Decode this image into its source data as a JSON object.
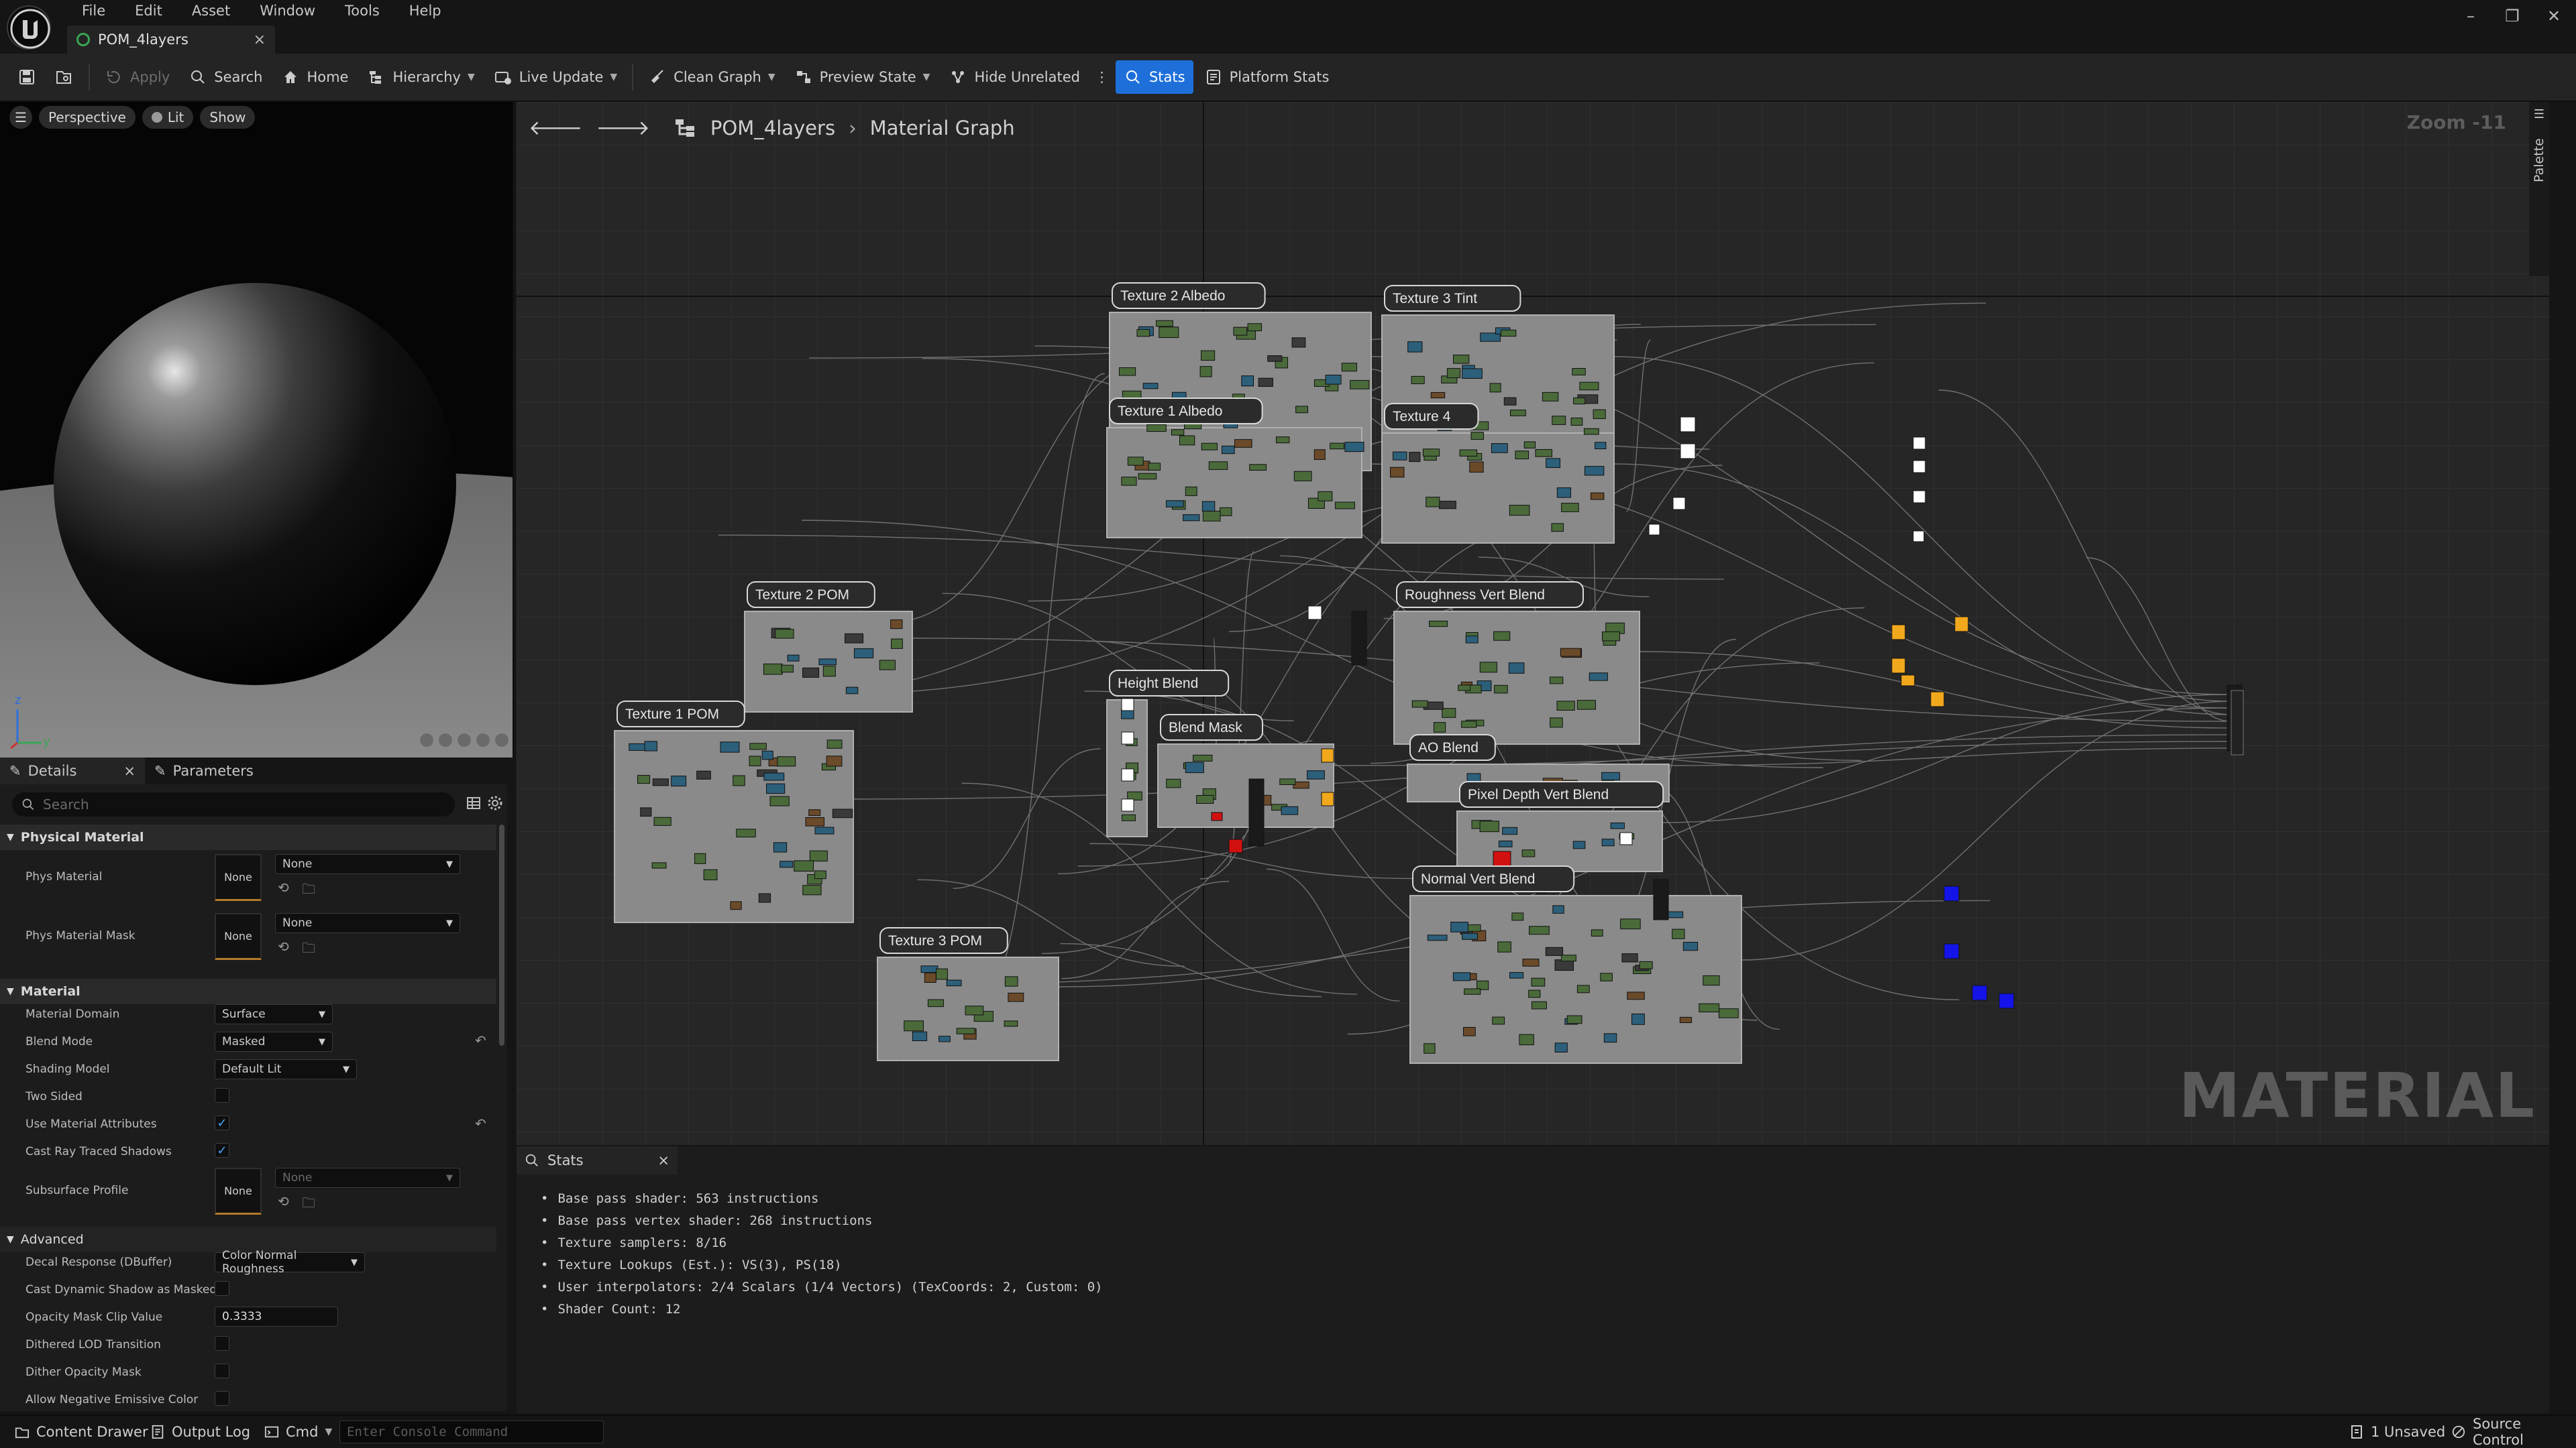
{
  "app": {
    "logo_icon": "unreal-engine-logo",
    "menu": [
      "File",
      "Edit",
      "Asset",
      "Window",
      "Tools",
      "Help"
    ],
    "document_tab": {
      "label": "POM_4layers",
      "icon": "material-icon",
      "close": "×"
    },
    "window_controls": [
      "–",
      "❐",
      "✕"
    ]
  },
  "toolbar": {
    "save_icon": "save-icon",
    "browse_icon": "browse-icon",
    "apply": "Apply",
    "search": "Search",
    "home": "Home",
    "hierarchy": "Hierarchy",
    "live_update": "Live Update",
    "clean_graph": "Clean Graph",
    "preview_state": "Preview State",
    "hide_unrelated": "Hide Unrelated",
    "stats": "Stats",
    "platform_stats": "Platform Stats"
  },
  "viewport": {
    "perspective": "Perspective",
    "lit": "Lit",
    "show": "Show"
  },
  "details": {
    "tabs": [
      "Details",
      "Parameters"
    ],
    "search_placeholder": "Search",
    "categories": {
      "physical_material": "Physical Material",
      "material": "Material",
      "advanced": "Advanced"
    },
    "props": {
      "phys_material": {
        "label": "Phys Material",
        "thumb": "None",
        "value": "None"
      },
      "phys_material_mask": {
        "label": "Phys Material Mask",
        "thumb": "None",
        "value": "None"
      },
      "material_domain": {
        "label": "Material Domain",
        "value": "Surface"
      },
      "blend_mode": {
        "label": "Blend Mode",
        "value": "Masked"
      },
      "shading_model": {
        "label": "Shading Model",
        "value": "Default Lit"
      },
      "two_sided": {
        "label": "Two Sided",
        "checked": false
      },
      "use_material_attributes": {
        "label": "Use Material Attributes",
        "checked": true
      },
      "cast_ray_traced_shadows": {
        "label": "Cast Ray Traced Shadows",
        "checked": true
      },
      "subsurface_profile": {
        "label": "Subsurface Profile",
        "thumb": "None",
        "value": "None"
      },
      "decal_response": {
        "label": "Decal Response (DBuffer)",
        "value": "Color Normal Roughness"
      },
      "cast_dynamic_shadow_as_masked": {
        "label": "Cast Dynamic Shadow as Masked",
        "checked": false
      },
      "opacity_mask_clip_value": {
        "label": "Opacity Mask Clip Value",
        "value": "0.3333"
      },
      "dithered_lod_transition": {
        "label": "Dithered LOD Transition",
        "checked": false
      },
      "dither_opacity_mask": {
        "label": "Dither Opacity Mask",
        "checked": false
      },
      "allow_negative_emissive": {
        "label": "Allow Negative Emissive Color",
        "checked": false
      }
    }
  },
  "graph": {
    "breadcrumb_root": "POM_4layers",
    "breadcrumb_leaf": "Material Graph",
    "zoom": "Zoom -11",
    "palette": "Palette",
    "watermark": "MATERIAL",
    "comments": {
      "tex2_albedo": "Texture 2 Albedo",
      "tex3_tint": "Texture 3 Tint",
      "tex1_albedo": "Texture 1 Albedo",
      "tex4": "Texture 4",
      "tex2_pom": "Texture 2 POM",
      "roughness_vert_blend": "Roughness Vert Blend",
      "tex1_pom": "Texture 1 POM",
      "height_blend": "Height Blend",
      "blend_mask": "Blend Mask",
      "ao_blend": "AO Blend",
      "pixel_depth_vert_blend": "Pixel Depth Vert Blend",
      "normal_vert_blend": "Normal Vert Blend",
      "tex3_pom": "Texture 3 POM"
    }
  },
  "stats": {
    "tab": "Stats",
    "lines": [
      "Base pass shader: 563 instructions",
      "Base pass vertex shader: 268 instructions",
      "Texture samplers: 8/16",
      "Texture Lookups (Est.): VS(3), PS(18)",
      "User interpolators: 2/4 Scalars (1/4 Vectors) (TexCoords: 2, Custom: 0)",
      "Shader Count: 12"
    ]
  },
  "statusbar": {
    "content_drawer": "Content Drawer",
    "output_log": "Output Log",
    "cmd": "Cmd",
    "console_placeholder": "Enter Console Command",
    "unsaved": "1 Unsaved",
    "source_control": "Source Control"
  },
  "colors": {
    "accent": "#1e6fd9",
    "comment_box": "#8a8a8a",
    "node_yellow": "#f2a81d",
    "node_blue": "#1414e8",
    "node_red": "#d21010",
    "node_green": "#4a6a3a"
  }
}
